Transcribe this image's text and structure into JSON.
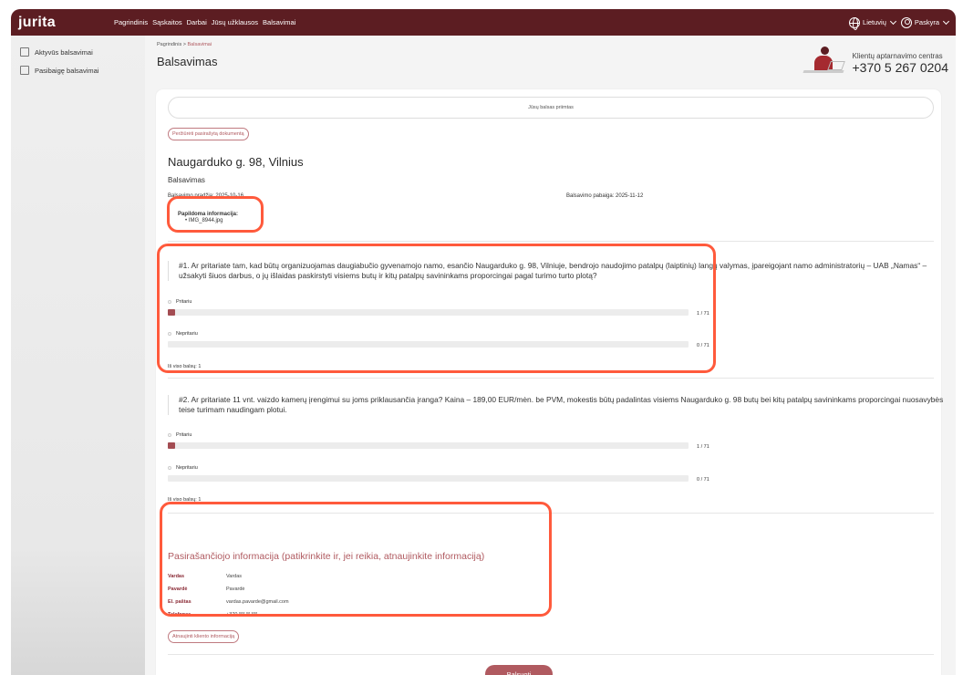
{
  "app": {
    "logo": "jurita"
  },
  "topnav": [
    "Pagrindinis",
    "Sąskaitos",
    "Darbai",
    "Jūsų užklausos",
    "Balsavimai"
  ],
  "topright": {
    "language": "Lietuvių",
    "account": "Paskyra"
  },
  "sidebar": {
    "items": [
      {
        "label": "Aktyvūs balsavimai",
        "icon": "ballot-icon"
      },
      {
        "label": "Pasibaigę balsavimai",
        "icon": "archive-icon"
      }
    ]
  },
  "breadcrumb": {
    "home": "Pagrindinis",
    "separator": ">",
    "current": "Balsavimai"
  },
  "page_title": "Balsavimas",
  "support": {
    "label": "Klientų aptarnavimo centras",
    "phone": "+370 5 267 0204"
  },
  "banner": "Jūsų balsas priimtas",
  "view_signed_doc": "Peržiūrėti pasirašytą dokumentą",
  "address": "Naugarduko g. 98, Vilnius",
  "section_title": "Balsavimas",
  "dates": {
    "start": "Balsavimo pradžia: 2025-10-16",
    "end": "Balsavimo pabaiga: 2025-11-12"
  },
  "additional_info": {
    "title": "Papildoma informacija:",
    "file": "IMG_8944.jpg"
  },
  "questions": [
    {
      "text": "#1. Ar pritariate tam, kad būtų organizuojamas daugiabučio gyvenamojo namo, esančio Naugarduko g. 98, Vilniuje, bendrojo naudojimo patalpų (laiptinių) langų valymas, įpareigojant namo administratorių – UAB „Namas“ – užsakyti šiuos darbus, o jų išlaidas paskirstyti visiems butų ir kitų patalpų savininkams proporcingai pagal turimo turto plotą?",
      "options": [
        {
          "label": "Pritariu",
          "count": "1 / 71",
          "fraction": 0.0141
        },
        {
          "label": "Nepritariu",
          "count": "0 / 71",
          "fraction": 0
        }
      ],
      "total": "Iš viso balsų: 1"
    },
    {
      "text": "#2. Ar pritariate 11 vnt. vaizdo kamerų įrengimui su joms priklausančia įranga? Kaina – 189,00 EUR/mėn. be PVM, mokestis būtų padalintas visiems Naugarduko g. 98 butų bei kitų patalpų savininkams proporcingai nuosavybės teise turimam naudingam plotui.",
      "options": [
        {
          "label": "Pritariu",
          "count": "1 / 71",
          "fraction": 0.0141
        },
        {
          "label": "Nepritariu",
          "count": "0 / 71",
          "fraction": 0
        }
      ],
      "total": "Iš viso balsų: 1"
    }
  ],
  "signer": {
    "title": "Pasirašančiojo informacija (patikrinkite ir, jei reikia, atnaujinkite informaciją)",
    "rows": [
      {
        "key": "Vardas",
        "value": "Vardas"
      },
      {
        "key": "Pavardė",
        "value": "Pavardė"
      },
      {
        "key": "El. paštas",
        "value": "vardas.pavarde@gmail.com"
      },
      {
        "key": "Telefonas",
        "value": "+370 *** ** ***"
      }
    ],
    "update_button": "Atnaujinti kliento informaciją"
  },
  "vote_button": "Balsuoti",
  "colors": {
    "brand": "#5c1d22",
    "accent": "#b05a60",
    "highlight": "#ff5a3c"
  }
}
